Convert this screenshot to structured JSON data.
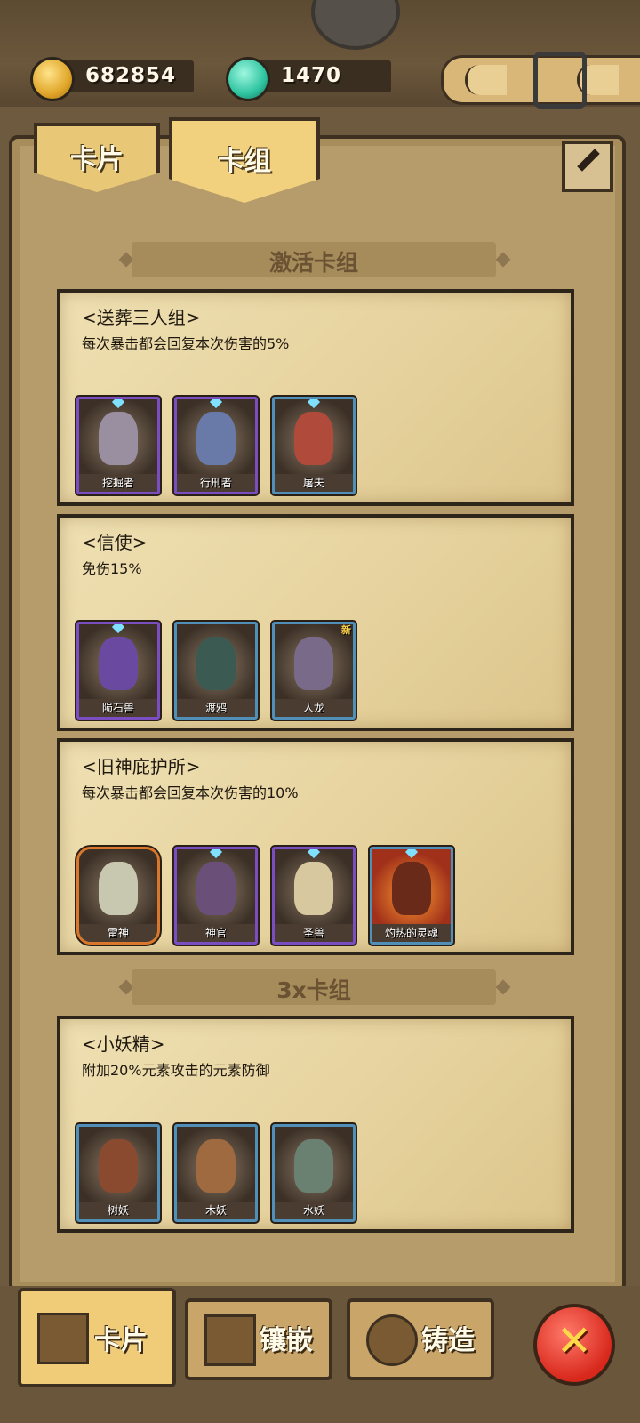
{
  "resources": {
    "gold": {
      "value": "682854",
      "icon": "gold-nugget-icon"
    },
    "gems": {
      "value": "1470",
      "icon": "gem-icon"
    }
  },
  "tabs": [
    {
      "label": "卡片",
      "active": false
    },
    {
      "label": "卡组",
      "active": true
    }
  ],
  "sections": {
    "active": {
      "title": "激活卡组"
    },
    "triple": {
      "title": "3x卡组"
    }
  },
  "groups": [
    {
      "name": "<送葬三人组>",
      "desc": "每次暴击都会回复本次伤害的5%",
      "cards": [
        {
          "name": "挖掘者"
        },
        {
          "name": "行刑者"
        },
        {
          "name": "屠夫"
        }
      ]
    },
    {
      "name": "<信使>",
      "desc": "免伤15%",
      "cards": [
        {
          "name": "陨石兽"
        },
        {
          "name": "渡鸦"
        },
        {
          "name": "人龙",
          "badge": "新"
        }
      ]
    },
    {
      "name": "<旧神庇护所>",
      "desc": "每次暴击都会回复本次伤害的10%",
      "cards": [
        {
          "name": "雷神"
        },
        {
          "name": "神官"
        },
        {
          "name": "圣兽"
        },
        {
          "name": "灼热的灵魂"
        }
      ]
    },
    {
      "name": "<小妖精>",
      "desc": "附加20%元素攻击的元素防御",
      "cards": [
        {
          "name": "树妖"
        },
        {
          "name": "木妖"
        },
        {
          "name": "水妖"
        }
      ]
    }
  ],
  "bottom_nav": [
    {
      "label": "卡片",
      "icon": "card-icon",
      "active": true
    },
    {
      "label": "镶嵌",
      "icon": "book-icon",
      "active": false
    },
    {
      "label": "铸造",
      "icon": "forge-icon",
      "active": false
    }
  ],
  "close": {
    "label": "✕",
    "icon": "close-icon"
  },
  "colors": {
    "purple_frame": "#7a4ec0",
    "blue_frame": "#4f8fb8",
    "orange_frame": "#d9782c",
    "parchment": "#e8d6a4"
  }
}
